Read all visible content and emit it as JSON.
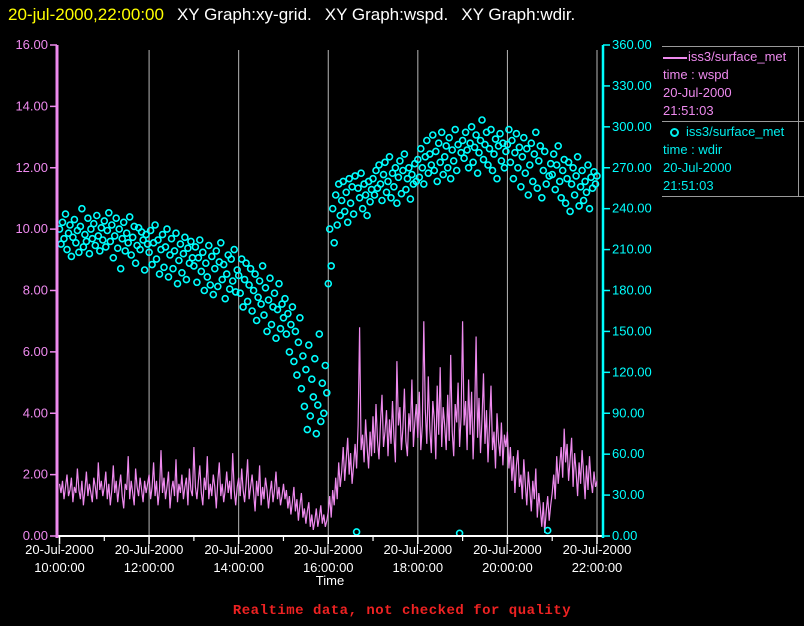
{
  "colors": {
    "background": "#000000",
    "timestamp_yellow": "#ffff00",
    "title_white": "#ffffff",
    "wspd_violet": "#ee8aee",
    "wdir_cyan": "#00ffff",
    "grid_gray": "#b8b8b8",
    "axis_white": "#ffffff",
    "legend_rule_gray": "#9a9a9a",
    "notice_red": "#ee2222"
  },
  "title_bar": {
    "timestamp": "20-jul-2000,22:00:00",
    "items": [
      "XY Graph:xy-grid.",
      "XY Graph:wspd.",
      "XY Graph:wdir."
    ]
  },
  "legend": {
    "entries": [
      {
        "symbol": "line",
        "color": "#ee8aee",
        "source": "iss3/surface_met",
        "field": "time : wspd",
        "date": "20-Jul-2000",
        "time": "21:51:03"
      },
      {
        "symbol": "open-circle",
        "color": "#00ffff",
        "source": "iss3/surface_met",
        "field": "time : wdir",
        "date": "20-Jul-2000",
        "time": "21:51:03"
      }
    ]
  },
  "footer": {
    "notice": "Realtime data, not checked for quality"
  },
  "chart_data": {
    "type": "mixed",
    "title": "",
    "x_axis": {
      "label": "Time",
      "date": "20-Jul-2000",
      "start_time": "10:00:00",
      "end_time": "22:00:00",
      "span_minutes": 720,
      "major_tick_hours": 2,
      "minor_tick_hours": 1,
      "ticks": [
        {
          "date": "20-Jul-2000",
          "time": "10:00:00"
        },
        {
          "date": "20-Jul-2000",
          "time": "12:00:00"
        },
        {
          "date": "20-Jul-2000",
          "time": "14:00:00"
        },
        {
          "date": "20-Jul-2000",
          "time": "16:00:00"
        },
        {
          "date": "20-Jul-2000",
          "time": "18:00:00"
        },
        {
          "date": "20-Jul-2000",
          "time": "20:00:00"
        },
        {
          "date": "20-Jul-2000",
          "time": "22:00:00"
        }
      ]
    },
    "y_left_axis": {
      "name": "wspd",
      "min": 0,
      "max": 16,
      "tick_step": 2,
      "color": "#ee8aee",
      "tick_labels": [
        "0.00",
        "2.00",
        "4.00",
        "6.00",
        "8.00",
        "10.00",
        "12.00",
        "14.00",
        "16.00"
      ]
    },
    "y_right_axis": {
      "name": "wdir",
      "min": 0,
      "max": 360,
      "tick_step": 30,
      "color": "#00ffff",
      "tick_labels": [
        "0.00",
        "30.00",
        "60.00",
        "90.00",
        "120.00",
        "150.00",
        "180.00",
        "210.00",
        "240.00",
        "270.00",
        "300.00",
        "330.00",
        "360.00"
      ]
    },
    "grid": {
      "color": "#b8b8b8",
      "vertical_lines_at": [
        "12:00:00",
        "14:00:00",
        "16:00:00",
        "18:00:00",
        "20:00:00",
        "22:00:00"
      ]
    },
    "series": [
      {
        "name": "wspd",
        "source": "iss3/surface_met",
        "type": "line",
        "axis": "left",
        "color": "#ee8aee",
        "start_minute": 0,
        "step_minutes": 2,
        "values": [
          1.7,
          1.4,
          1.8,
          1.2,
          1.6,
          2.0,
          1.3,
          1.5,
          1.9,
          1.1,
          1.6,
          1.4,
          2.2,
          1.5,
          1.2,
          1.8,
          1.0,
          1.5,
          2.1,
          1.3,
          1.7,
          1.4,
          1.1,
          1.9,
          1.6,
          1.2,
          2.4,
          1.5,
          1.8,
          1.3,
          1.6,
          2.1,
          1.2,
          1.7,
          1.0,
          1.5,
          2.3,
          1.4,
          1.8,
          1.1,
          1.6,
          2.0,
          1.3,
          0.9,
          1.7,
          1.5,
          2.6,
          1.2,
          1.8,
          1.4,
          1.0,
          2.2,
          1.6,
          1.3,
          1.9,
          1.5,
          1.1,
          1.8,
          1.4,
          1.7,
          2.0,
          1.2,
          1.6,
          2.4,
          1.3,
          1.8,
          1.0,
          1.5,
          2.8,
          1.4,
          1.9,
          1.2,
          1.6,
          2.1,
          0.9,
          1.5,
          1.8,
          1.3,
          2.5,
          1.1,
          1.7,
          1.4,
          2.0,
          1.2,
          1.6,
          1.9,
          1.0,
          2.2,
          1.5,
          1.3,
          2.9,
          1.6,
          1.2,
          1.8,
          2.3,
          1.4,
          1.0,
          1.9,
          1.5,
          2.6,
          1.2,
          1.7,
          1.3,
          2.0,
          1.6,
          0.9,
          1.8,
          2.4,
          1.3,
          1.7,
          1.1,
          1.5,
          2.1,
          1.4,
          1.8,
          1.2,
          2.7,
          1.5,
          1.0,
          1.6,
          1.9,
          1.3,
          2.2,
          1.5,
          1.1,
          1.7,
          2.5,
          1.2,
          1.6,
          2.0,
          1.4,
          0.8,
          1.8,
          1.3,
          2.3,
          1.0,
          1.6,
          1.2,
          1.9,
          1.5,
          0.9,
          1.4,
          1.8,
          1.1,
          1.5,
          2.1,
          1.2,
          1.6,
          1.0,
          1.3,
          1.7,
          1.2,
          1.5,
          0.9,
          1.3,
          0.7,
          1.1,
          1.6,
          0.8,
          1.2,
          0.5,
          1.0,
          1.4,
          0.6,
          0.9,
          0.4,
          0.8,
          1.1,
          0.3,
          0.7,
          0.2,
          0.5,
          0.9,
          0.3,
          0.6,
          1.0,
          0.4,
          0.7,
          0.3,
          0.5,
          0.8,
          1.3,
          0.6,
          1.5,
          1.0,
          1.9,
          1.2,
          2.4,
          1.6,
          2.1,
          2.9,
          1.8,
          2.5,
          3.2,
          2.0,
          2.7,
          1.7,
          2.3,
          3.0,
          2.2,
          3.6,
          6.8,
          2.8,
          3.3,
          2.4,
          3.8,
          2.9,
          2.2,
          3.4,
          2.6,
          3.9,
          2.7,
          4.3,
          3.1,
          2.5,
          3.7,
          4.6,
          2.9,
          3.4,
          4.1,
          2.6,
          3.8,
          3.0,
          4.4,
          3.3,
          2.4,
          5.7,
          3.6,
          4.2,
          2.8,
          3.5,
          4.8,
          3.1,
          2.6,
          4.0,
          3.4,
          5.1,
          2.9,
          3.7,
          4.3,
          3.2,
          4.7,
          2.8,
          3.6,
          7.0,
          4.1,
          3.0,
          5.2,
          3.5,
          2.7,
          4.4,
          3.8,
          2.5,
          4.9,
          3.3,
          5.5,
          2.9,
          4.2,
          3.6,
          2.8,
          4.6,
          3.1,
          5.9,
          3.4,
          2.6,
          4.3,
          3.7,
          5.0,
          2.9,
          3.9,
          7.0,
          3.6,
          4.4,
          2.8,
          5.1,
          3.3,
          4.7,
          2.5,
          3.9,
          6.5,
          3.2,
          4.5,
          2.7,
          3.8,
          5.3,
          3.0,
          4.1,
          2.4,
          3.6,
          4.9,
          2.8,
          3.4,
          2.2,
          4.0,
          3.1,
          2.6,
          3.7,
          2.3,
          3.3,
          2.9,
          3.4,
          2.2,
          2.9,
          1.8,
          2.6,
          1.4,
          2.3,
          2.8,
          1.6,
          2.0,
          1.2,
          2.5,
          1.7,
          1.0,
          2.1,
          1.5,
          0.8,
          1.8,
          1.2,
          2.2,
          0.6,
          1.4,
          0.9,
          0.3,
          1.1,
          0.1,
          0.8,
          1.3,
          0.5,
          1.0,
          1.4,
          2.0,
          1.2,
          2.6,
          1.7,
          2.3,
          2.9,
          1.9,
          3.5,
          2.4,
          3.0,
          1.8,
          2.5,
          3.2,
          1.6,
          2.7,
          2.1,
          1.3,
          2.4,
          1.7,
          2.8,
          2.0,
          1.2,
          2.3,
          1.5,
          2.6,
          1.8,
          1.4,
          2.1,
          1.6,
          1.8
        ]
      },
      {
        "name": "wdir",
        "source": "iss3/surface_met",
        "type": "scatter",
        "marker": "open-circle",
        "axis": "right",
        "color": "#00ffff",
        "start_minute": 0,
        "step_minutes": 2,
        "values": [
          225,
          214,
          230,
          218,
          236,
          210,
          222,
          228,
          205,
          219,
          232,
          215,
          224,
          208,
          227,
          240,
          212,
          221,
          216,
          233,
          207,
          225,
          218,
          229,
          213,
          235,
          220,
          209,
          226,
          217,
          231,
          212,
          224,
          237,
          216,
          228,
          204,
          220,
          233,
          211,
          225,
          196,
          218,
          230,
          209,
          222,
          215,
          234,
          206,
          219,
          227,
          200,
          213,
          226,
          210,
          223,
          217,
          195,
          221,
          214,
          208,
          224,
          199,
          215,
          228,
          203,
          217,
          192,
          210,
          221,
          197,
          212,
          225,
          190,
          206,
          218,
          196,
          209,
          222,
          185,
          202,
          214,
          193,
          207,
          219,
          188,
          211,
          200,
          216,
          204,
          198,
          212,
          186,
          204,
          217,
          194,
          208,
          180,
          200,
          190,
          213,
          184,
          205,
          177,
          196,
          209,
          183,
          201,
          215,
          188,
          199,
          174,
          192,
          206,
          181,
          203,
          187,
          210,
          179,
          195,
          191,
          178,
          203,
          168,
          188,
          200,
          172,
          184,
          196,
          165,
          180,
          192,
          158,
          175,
          187,
          170,
          198,
          162,
          182,
          150,
          173,
          189,
          155,
          168,
          178,
          145,
          166,
          185,
          152,
          170,
          160,
          174,
          148,
          163,
          135,
          155,
          168,
          128,
          150,
          118,
          142,
          160,
          108,
          132,
          95,
          122,
          78,
          140,
          88,
          115,
          102,
          130,
          75,
          96,
          148,
          84,
          112,
          90,
          125,
          105,
          185,
          225,
          198,
          240,
          215,
          250,
          228,
          258,
          235,
          246,
          260,
          238,
          252,
          230,
          262,
          244,
          256,
          236,
          264,
          3,
          255,
          248,
          266,
          240,
          258,
          250,
          235,
          260,
          245,
          254,
          262,
          250,
          268,
          255,
          272,
          258,
          246,
          265,
          274,
          252,
          260,
          278,
          248,
          266,
          256,
          270,
          244,
          263,
          275,
          251,
          268,
          280,
          254,
          262,
          270,
          247,
          265,
          258,
          273,
          260,
          276,
          263,
          284,
          270,
          258,
          278,
          290,
          266,
          280,
          272,
          294,
          268,
          282,
          260,
          288,
          274,
          296,
          265,
          278,
          286,
          270,
          292,
          262,
          283,
          275,
          298,
          268,
          287,
          2,
          281,
          290,
          277,
          296,
          283,
          270,
          288,
          300,
          274,
          285,
          294,
          266,
          281,
          290,
          305,
          276,
          287,
          296,
          272,
          284,
          298,
          268,
          280,
          291,
          262,
          286,
          295,
          275,
          288,
          270,
          282,
          287,
          298,
          274,
          290,
          262,
          281,
          295,
          270,
          285,
          256,
          278,
          292,
          266,
          284,
          250,
          272,
          288,
          260,
          280,
          296,
          255,
          275,
          286,
          248,
          268,
          282,
          258,
          4,
          264,
          273,
          265,
          280,
          254,
          272,
          286,
          260,
          248,
          268,
          276,
          244,
          262,
          274,
          238,
          258,
          270,
          250,
          264,
          278,
          242,
          256,
          268,
          246,
          260,
          252,
          272,
          240,
          263,
          255,
          267,
          258,
          264
        ]
      }
    ]
  }
}
